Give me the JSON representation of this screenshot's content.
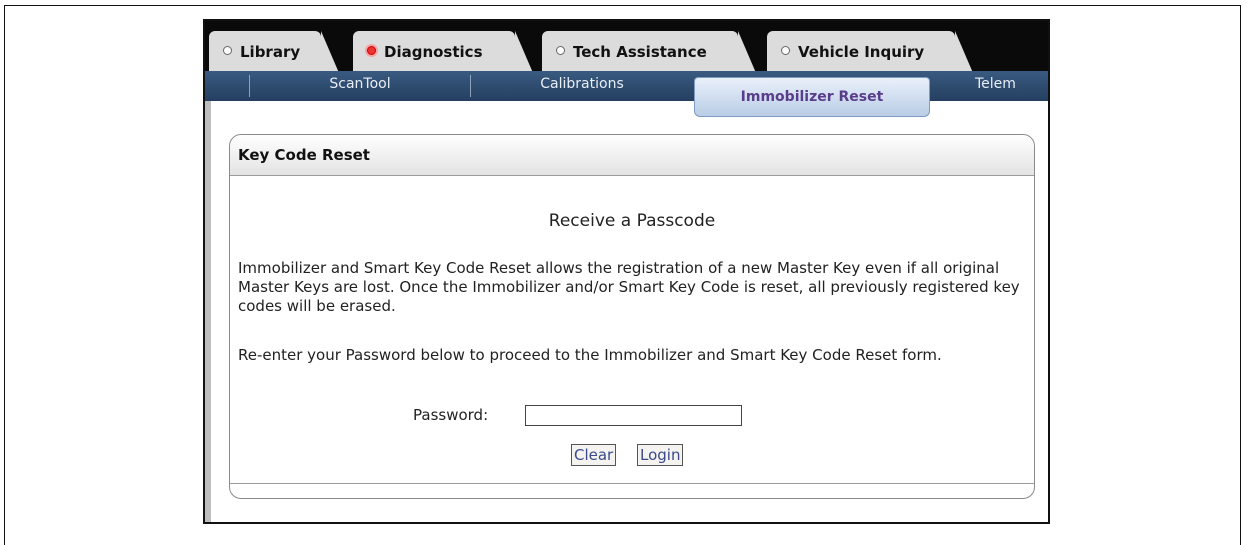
{
  "main_tabs": [
    {
      "label": "Library",
      "active": false
    },
    {
      "label": "Diagnostics",
      "active": true
    },
    {
      "label": "Tech Assistance",
      "active": false
    },
    {
      "label": "Vehicle Inquiry",
      "active": false
    }
  ],
  "sub_nav": [
    {
      "label": "ScanTool"
    },
    {
      "label": "Calibrations"
    },
    {
      "label": "Immobilizer Reset",
      "active": true
    },
    {
      "label": "Telem"
    }
  ],
  "panel": {
    "header": "Key Code Reset",
    "title": "Receive a Passcode",
    "paragraph1": "Immobilizer and Smart Key Code Reset allows the registration of a new Master Key even if all original Master Keys are lost. Once the Immobilizer and/or Smart Key Code is reset, all previously registered key codes will be erased.",
    "paragraph2": "Re-enter your Password below to proceed to the Immobilizer and Smart Key Code Reset form.",
    "password_label": "Password:",
    "password_value": "",
    "clear_label": "Clear",
    "login_label": "Login"
  },
  "colors": {
    "tab_strip": "#0a0a0a",
    "sub_nav": "#2e4a6e",
    "active_sub_text": "#5a3d8a",
    "active_dot": "#e33333"
  },
  "icons": {
    "tab_indicator": "radio-dot-icon",
    "active_tab_indicator": "red-radio-dot-icon"
  }
}
